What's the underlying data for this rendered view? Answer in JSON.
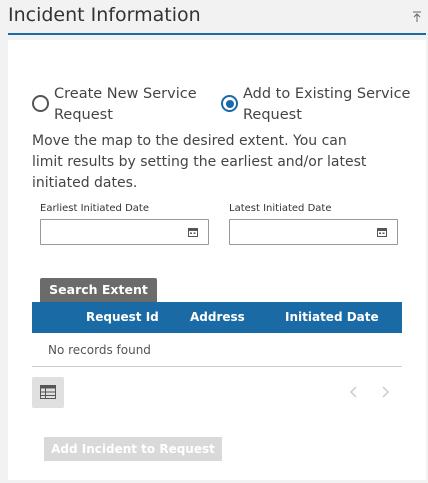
{
  "header": {
    "title": "Incident Information",
    "collapse_icon": "collapse-up-icon"
  },
  "mode": {
    "options": [
      {
        "label": "Create New Service Request",
        "selected": false
      },
      {
        "label": "Add to Existing Service Request",
        "selected": true
      }
    ]
  },
  "instructions": "Move the map to the desired extent. You can limit results by setting the earliest and/or latest initiated dates.",
  "dates": {
    "earliest_label": "Earliest Initiated Date",
    "earliest_value": "",
    "latest_label": "Latest Initiated Date",
    "latest_value": "",
    "icon": "calendar-icon"
  },
  "search_button": "Search Extent",
  "table": {
    "columns": [
      "Request Id",
      "Address",
      "Initiated Date"
    ],
    "rows": [],
    "empty_text": "No records found"
  },
  "toolbar": {
    "grid_icon": "table-grid-icon",
    "prev_icon": "chevron-left-icon",
    "next_icon": "chevron-right-icon"
  },
  "add_button": "Add Incident to Request",
  "colors": {
    "accent": "#1a6aa6",
    "search_button": "#6b6b6b",
    "disabled_button": "#d9d9d9"
  }
}
